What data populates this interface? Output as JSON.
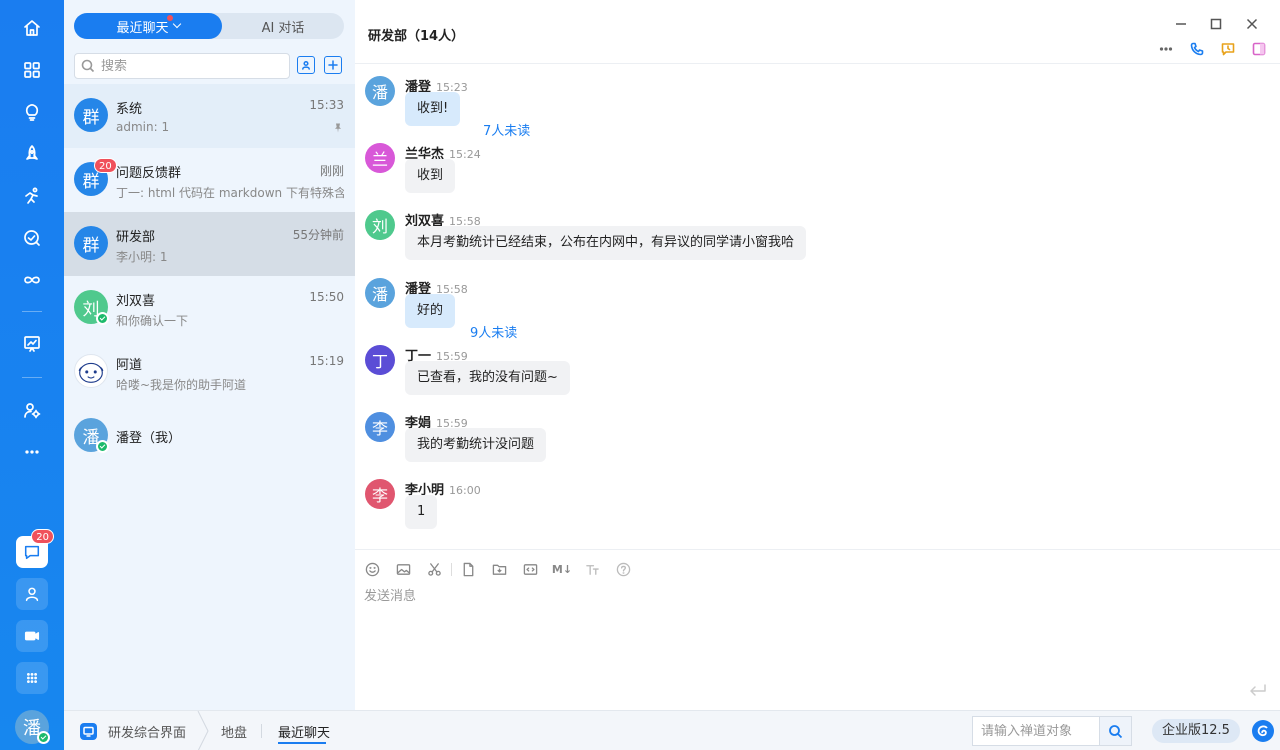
{
  "tabs": {
    "recent_label": "最近聊天",
    "ai_label": "AI 对话"
  },
  "search": {
    "placeholder": "搜索"
  },
  "conversations": [
    {
      "avatar": "群",
      "name": "系统",
      "time": "15:33",
      "preview": "admin: 1",
      "color": "#2586e8",
      "pinned": true
    },
    {
      "avatar": "群",
      "name": "问题反馈群",
      "time": "刚刚",
      "preview": "丁一: html 代码在 markdown 下有特殊含义",
      "badge": "20",
      "color": "#2586e8"
    },
    {
      "avatar": "群",
      "name": "研发部",
      "time": "55分钟前",
      "preview": "李小明: 1",
      "color": "#2586e8",
      "selected": true
    },
    {
      "avatar": "刘",
      "name": "刘双喜",
      "time": "15:50",
      "preview": "和你确认一下",
      "color": "#4fc98d"
    },
    {
      "avatar": "",
      "name": "阿道",
      "time": "15:19",
      "preview": "哈喽~我是你的助手阿道"
    },
    {
      "avatar": "潘",
      "name": "潘登（我）",
      "time": "",
      "preview": "",
      "color": "#5aa3dd"
    }
  ],
  "chat": {
    "title": "研发部（14人）",
    "messages": [
      {
        "avatar": "潘",
        "color": "#5aa3dd",
        "sender": "潘登",
        "time": "15:23",
        "text": "收到!",
        "mine": true,
        "unread": "7人未读"
      },
      {
        "avatar": "兰",
        "color": "#d858d8",
        "sender": "兰华杰",
        "time": "15:24",
        "text": "收到"
      },
      {
        "avatar": "刘",
        "color": "#4fc98d",
        "sender": "刘双喜",
        "time": "15:58",
        "text": "本月考勤统计已经结束，公布在内网中，有异议的同学请小窗我哈"
      },
      {
        "avatar": "潘",
        "color": "#5aa3dd",
        "sender": "潘登",
        "time": "15:58",
        "text": "好的",
        "mine": true,
        "unread": "9人未读"
      },
      {
        "avatar": "丁",
        "color": "#5b4dd6",
        "sender": "丁一",
        "time": "15:59",
        "text": "已查看，我的没有问题~"
      },
      {
        "avatar": "李",
        "color": "#4f8fe0",
        "sender": "李娟",
        "time": "15:59",
        "text": "我的考勤统计没问题"
      },
      {
        "avatar": "李",
        "color": "#e0566f",
        "sender": "李小明",
        "time": "16:00",
        "text": "1"
      }
    ],
    "compose_placeholder": "发送消息",
    "md_label": "M↓"
  },
  "rail": {
    "chat_badge": "20",
    "avatar": "潘"
  },
  "bottombar": {
    "breadcrumb": [
      "研发综合界面",
      "地盘",
      "最近聊天"
    ],
    "search_placeholder": "请输入禅道对象",
    "edition": "企业版12.5"
  }
}
